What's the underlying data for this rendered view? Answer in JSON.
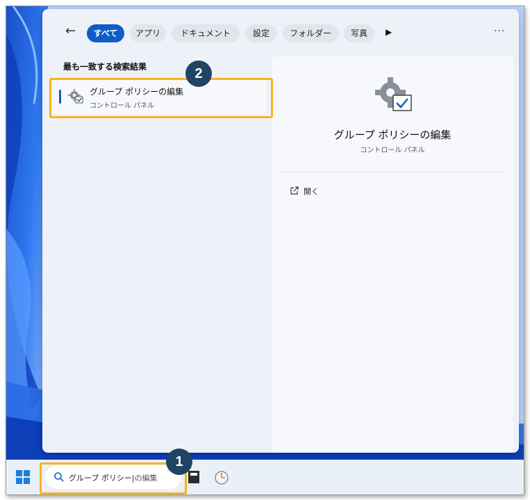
{
  "filters": {
    "back_icon": "arrow-left-icon",
    "tabs": [
      "すべて",
      "アプリ",
      "ドキュメント",
      "設定",
      "フォルダー",
      "写真"
    ],
    "more_icon": "play-icon",
    "overflow": "···"
  },
  "results": {
    "section_title": "最も一致する検索結果",
    "best": {
      "title": "グループ ポリシーの編集",
      "subtitle": "コントロール パネル",
      "icon": "gear-check-icon"
    }
  },
  "preview": {
    "title": "グループ ポリシーの編集",
    "subtitle": "コントロール パネル",
    "icon": "gear-check-icon",
    "actions": [
      {
        "label": "開く",
        "icon": "open-external-icon"
      }
    ]
  },
  "taskbar": {
    "start_icon": "windows-logo-icon",
    "search_typed": "グループ ポリシー",
    "search_rest": "の編集",
    "search_icon": "search-icon",
    "apps": [
      "file-app-icon",
      "clock-app-icon"
    ]
  },
  "annotations": {
    "step1": "1",
    "step2": "2",
    "highlight_color": "#f6b51c",
    "badge_color": "#1f4464"
  },
  "colors": {
    "accent": "#0f5cc7"
  }
}
